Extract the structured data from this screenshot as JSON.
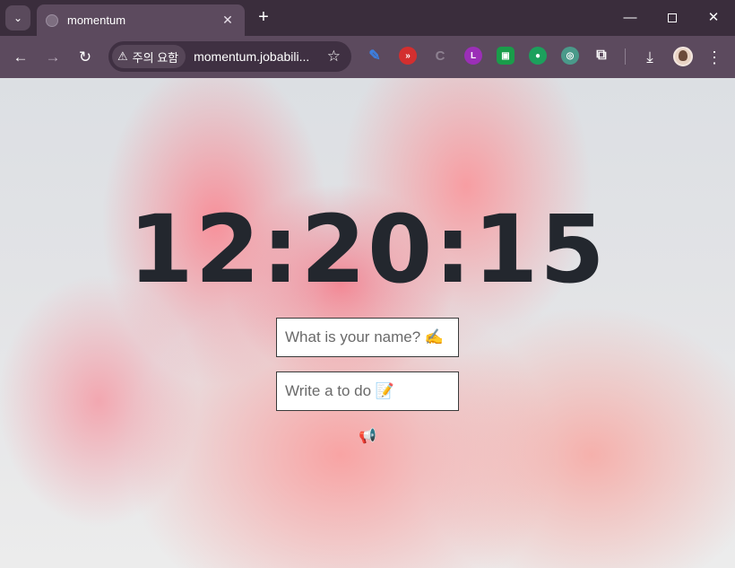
{
  "browser": {
    "tab": {
      "title": "momentum"
    },
    "toolbar": {
      "security_label": "주의 요함",
      "url": "momentum.jobabili..."
    },
    "icons": {
      "tab_search": "chevron-down-icon",
      "new_tab": "plus-icon",
      "back": "arrow-left-icon",
      "forward": "arrow-right-icon",
      "reload": "reload-icon",
      "bookmark": "star-icon",
      "download": "download-icon",
      "menu": "kebab-menu-icon"
    }
  },
  "page": {
    "clock": "12:20:15",
    "name_input": {
      "placeholder": "What is your name? ✍️",
      "value": ""
    },
    "todo_input": {
      "placeholder": "Write a to do 📝",
      "value": ""
    },
    "megaphone": "📢"
  }
}
